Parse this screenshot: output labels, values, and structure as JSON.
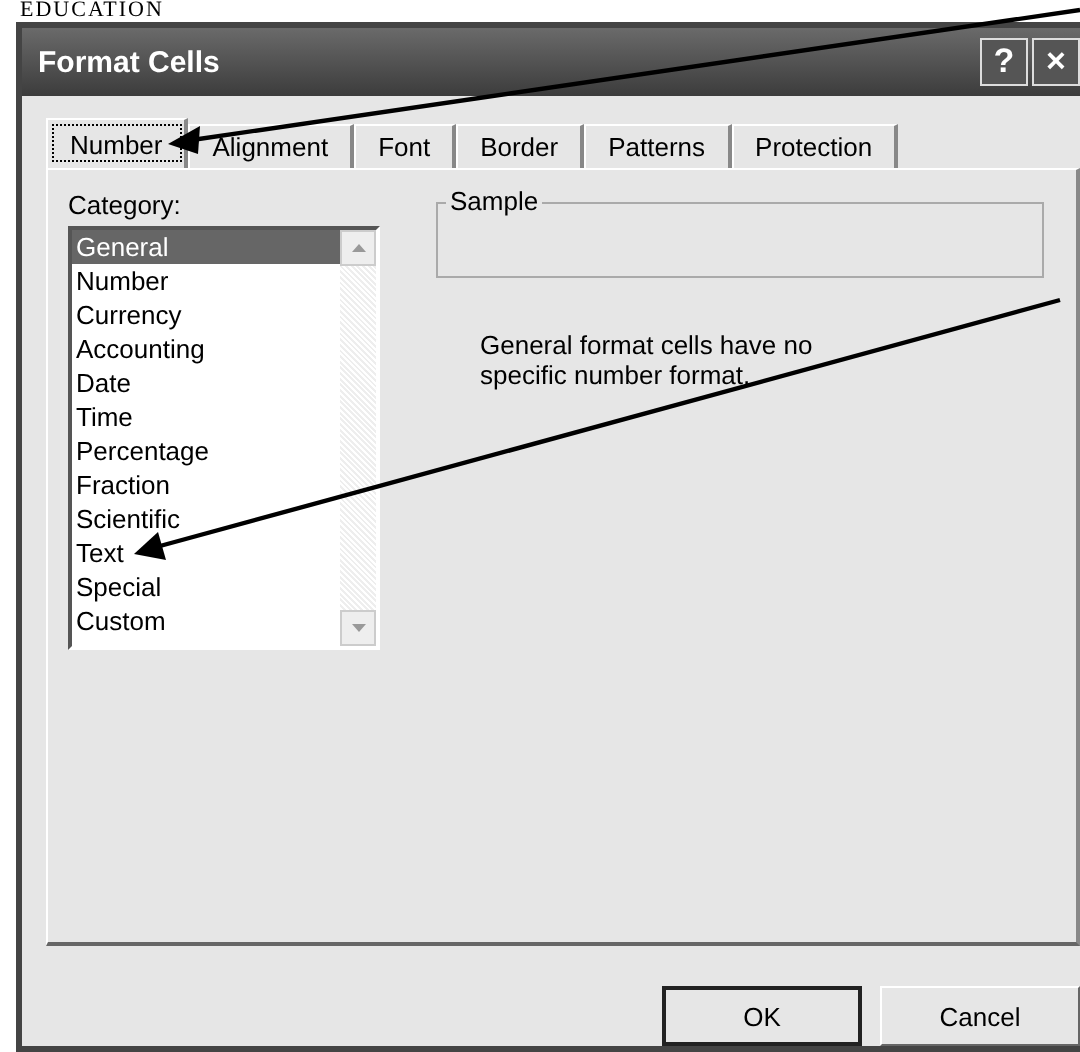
{
  "page_heading": "EDUCATION",
  "window": {
    "title": "Format Cells",
    "help_button": "?",
    "close_button": "×"
  },
  "tabs": [
    {
      "label": "Number",
      "selected": true
    },
    {
      "label": "Alignment",
      "selected": false
    },
    {
      "label": "Font",
      "selected": false
    },
    {
      "label": "Border",
      "selected": false
    },
    {
      "label": "Patterns",
      "selected": false
    },
    {
      "label": "Protection",
      "selected": false
    }
  ],
  "category": {
    "label": "Category:",
    "items": [
      {
        "label": "General",
        "selected": true
      },
      {
        "label": "Number",
        "selected": false
      },
      {
        "label": "Currency",
        "selected": false
      },
      {
        "label": "Accounting",
        "selected": false
      },
      {
        "label": "Date",
        "selected": false
      },
      {
        "label": "Time",
        "selected": false
      },
      {
        "label": "Percentage",
        "selected": false
      },
      {
        "label": "Fraction",
        "selected": false
      },
      {
        "label": "Scientific",
        "selected": false
      },
      {
        "label": "Text",
        "selected": false
      },
      {
        "label": "Special",
        "selected": false
      },
      {
        "label": "Custom",
        "selected": false
      }
    ]
  },
  "sample": {
    "label": "Sample"
  },
  "description": "General format cells have no specific number format.",
  "buttons": [
    "OK",
    "Cancel"
  ]
}
